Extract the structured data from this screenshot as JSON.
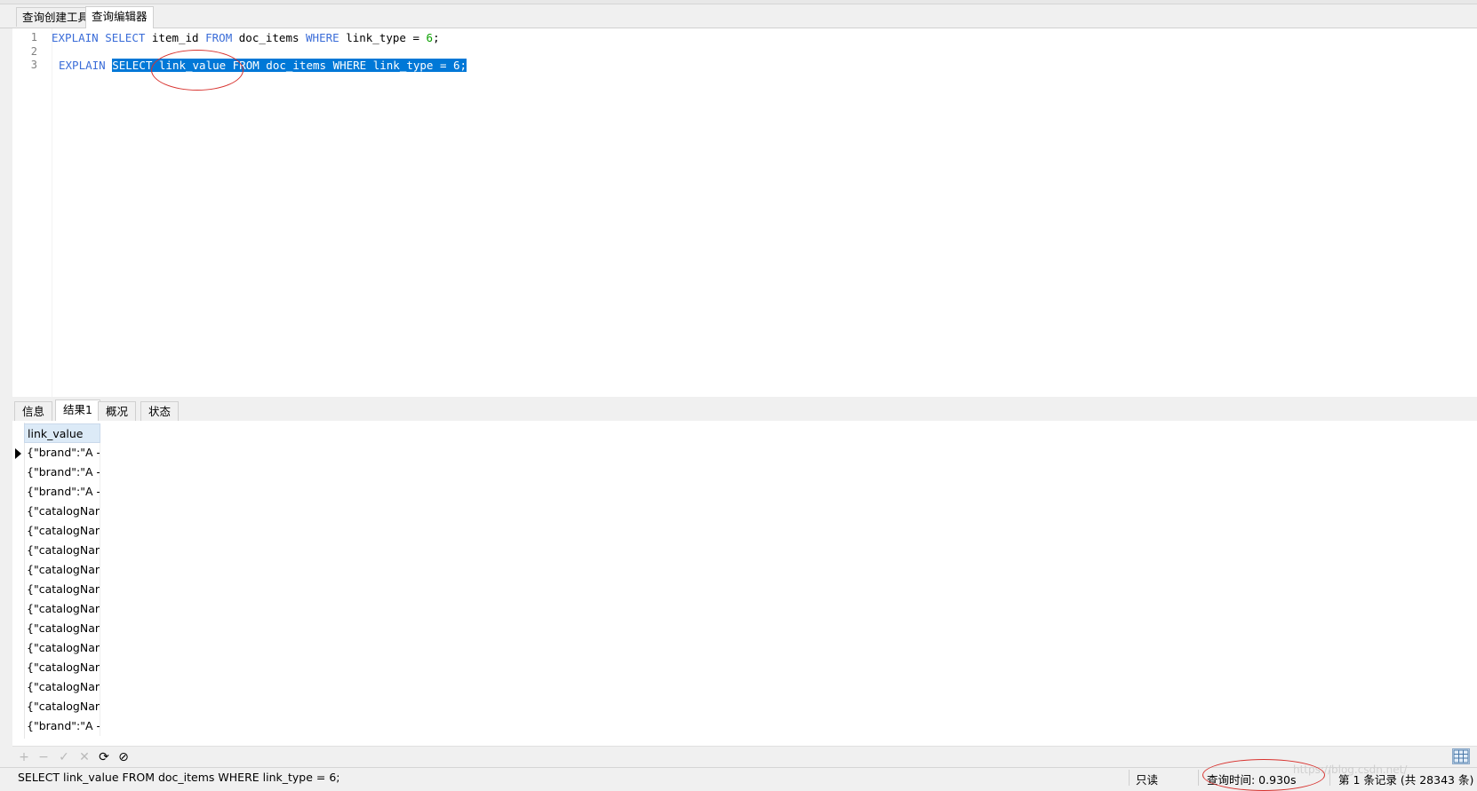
{
  "editor_tabs": [
    "查询创建工具",
    "查询编辑器"
  ],
  "editor": {
    "line_numbers": [
      "1",
      "2",
      "3"
    ],
    "line1": {
      "kw1": "EXPLAIN",
      "kw2": "SELECT",
      "t1": "item_id",
      "kw3": "FROM",
      "t2": "doc_items",
      "kw4": "WHERE",
      "t3": "link_type =",
      "num": "6",
      "t4": ";"
    },
    "line3": {
      "kw1": "EXPLAIN",
      "selected": "SELECT link_value FROM doc_items WHERE link_type = 6;"
    }
  },
  "result_tabs": [
    "信息",
    "结果1",
    "概况",
    "状态"
  ],
  "grid": {
    "column_header": "link_value",
    "rows": [
      "{\"brand\":\"A - 星",
      "{\"brand\":\"A - 星",
      "{\"brand\":\"A - 星",
      "{\"catalogName",
      "{\"catalogName",
      "{\"catalogName",
      "{\"catalogName",
      "{\"catalogName",
      "{\"catalogName",
      "{\"catalogName",
      "{\"catalogName",
      "{\"catalogName",
      "{\"catalogName",
      "{\"catalogName",
      "{\"brand\":\"A - 星"
    ]
  },
  "toolbar": {
    "add_icon": "plus-icon",
    "delete_icon": "minus-icon",
    "apply_icon": "check-icon",
    "discard_icon": "x-icon",
    "refresh_icon": "refresh-icon",
    "stop_icon": "stop-icon",
    "add": "+",
    "delete": "−",
    "apply": "✓",
    "discard": "✕",
    "refresh": "⟳",
    "stop": "⊘"
  },
  "statusbar": {
    "sql": "SELECT link_value FROM doc_items WHERE link_type = 6;",
    "mode": "只读",
    "query_time": "查询时间: 0.930s",
    "record": "第 1 条记录 (共 28343 条)",
    "watermark": "https://blog.csdn.net/"
  }
}
